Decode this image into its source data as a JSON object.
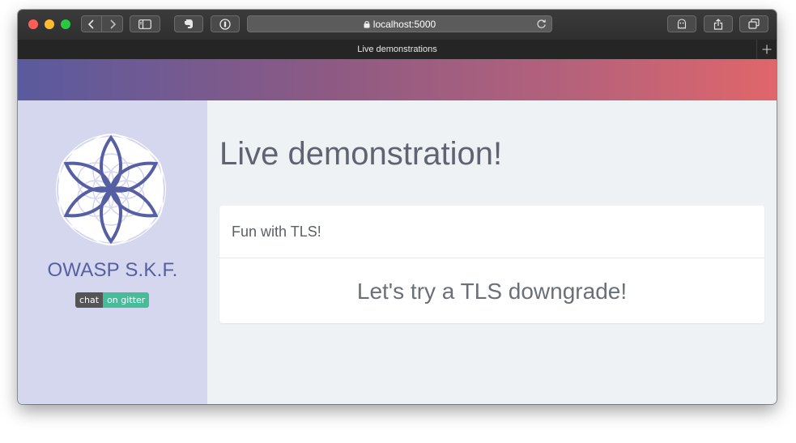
{
  "browser": {
    "url": "localhost:5000",
    "tab_title": "Live demonstrations"
  },
  "icons": {
    "back": "chevron-left-icon",
    "forward": "chevron-right-icon",
    "sidebar": "sidebar-icon",
    "extension": "evernote-icon",
    "password": "1password-icon",
    "lock": "lock-icon",
    "reload": "reload-icon",
    "ghost": "ghostery-icon",
    "share": "share-icon",
    "tabs": "tabs-overview-icon",
    "new_tab": "plus-icon"
  },
  "colors": {
    "sidebar_bg": "#d5d7ef",
    "brand": "#565fa3",
    "header_gradient_start": "#5a5a9e",
    "header_gradient_end": "#e0666a",
    "gitter_green": "#46bc99"
  },
  "sidebar": {
    "brand": "OWASP S.K.F.",
    "badge_left": "chat",
    "badge_right": "on gitter"
  },
  "main": {
    "title": "Live demonstration!",
    "card_header": "Fun with TLS!",
    "card_body": "Let's try a TLS downgrade!"
  }
}
